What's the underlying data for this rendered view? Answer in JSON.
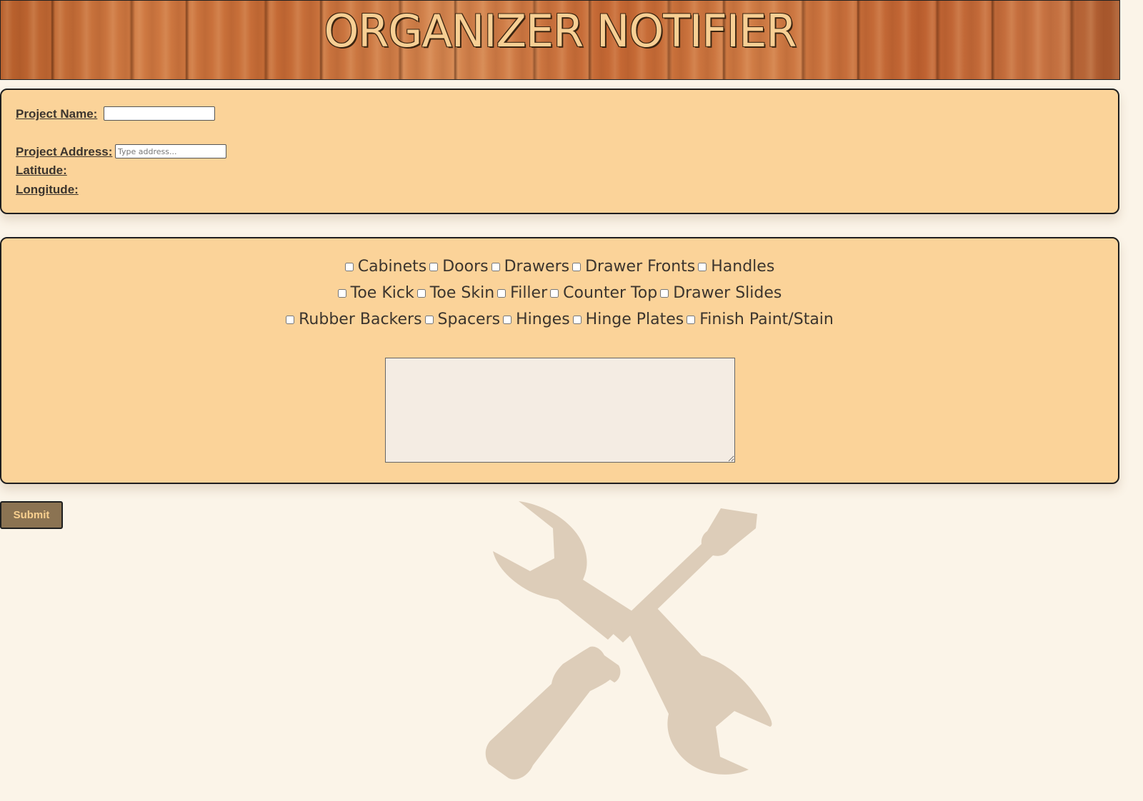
{
  "header": {
    "title": "ORGANIZER NOTIFIER"
  },
  "project": {
    "name_label": "Project Name:",
    "name_value": "",
    "address_label": "Project Address:",
    "address_placeholder": "Type address...",
    "address_value": "",
    "latitude_label": "Latitude:",
    "longitude_label": "Longitude:"
  },
  "items": {
    "rows": [
      [
        {
          "label": "Cabinets",
          "checked": false
        },
        {
          "label": "Doors",
          "checked": false
        },
        {
          "label": "Drawers",
          "checked": false
        },
        {
          "label": "Drawer Fronts",
          "checked": false
        },
        {
          "label": "Handles",
          "checked": false
        }
      ],
      [
        {
          "label": "Toe Kick",
          "checked": false
        },
        {
          "label": "Toe Skin",
          "checked": false
        },
        {
          "label": "Filler",
          "checked": false
        },
        {
          "label": "Counter Top",
          "checked": false
        },
        {
          "label": "Drawer Slides",
          "checked": false
        }
      ],
      [
        {
          "label": "Rubber Backers",
          "checked": false
        },
        {
          "label": "Spacers",
          "checked": false
        },
        {
          "label": "Hinges",
          "checked": false
        },
        {
          "label": "Hinge Plates",
          "checked": false
        },
        {
          "label": "Finish Paint/Stain",
          "checked": false
        }
      ]
    ],
    "notes_value": ""
  },
  "actions": {
    "submit_label": "Submit"
  },
  "decor": {
    "background_icon": "wrench-screwdriver-icon"
  },
  "colors": {
    "page_bg": "#fbf4e8",
    "panel_bg": "#fbd399",
    "title_text": "#f7cf94",
    "submit_bg": "#8b7352",
    "submit_text": "#f9d08f",
    "icon_fill": "#ddcdb9"
  }
}
